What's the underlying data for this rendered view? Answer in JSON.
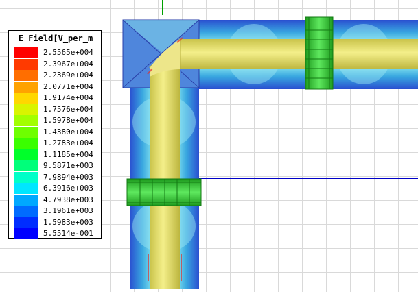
{
  "legend": {
    "title": "E Field[V_per_m",
    "entries": [
      {
        "label": "2.5565e+004",
        "color": "#ff0000"
      },
      {
        "label": "2.3967e+004",
        "color": "#ff3a00"
      },
      {
        "label": "2.2369e+004",
        "color": "#ff6e00"
      },
      {
        "label": "2.0771e+004",
        "color": "#ffa200"
      },
      {
        "label": "1.9174e+004",
        "color": "#ffd700"
      },
      {
        "label": "1.7576e+004",
        "color": "#d9f400"
      },
      {
        "label": "1.5978e+004",
        "color": "#a2ff00"
      },
      {
        "label": "1.4380e+004",
        "color": "#6eff00"
      },
      {
        "label": "1.2783e+004",
        "color": "#3aff00"
      },
      {
        "label": "1.1185e+004",
        "color": "#00ff2a"
      },
      {
        "label": "9.5871e+003",
        "color": "#00ff7a"
      },
      {
        "label": "7.9894e+003",
        "color": "#00ffc8"
      },
      {
        "label": "6.3916e+003",
        "color": "#00e6ff"
      },
      {
        "label": "4.7938e+003",
        "color": "#00a8ff"
      },
      {
        "label": "3.1961e+003",
        "color": "#006bff"
      },
      {
        "label": "1.5983e+003",
        "color": "#002dff"
      },
      {
        "label": "5.5514e-001",
        "color": "#0000ff"
      }
    ]
  },
  "colors": {
    "field_blue": "#3a62d8",
    "field_cyan": "#42c8e6",
    "field_light": "#9fe4f0",
    "conductor": "#e6e070",
    "sleeve": "#3fd23f",
    "axis_green": "#00a000",
    "axis_blue": "#0000c8"
  }
}
